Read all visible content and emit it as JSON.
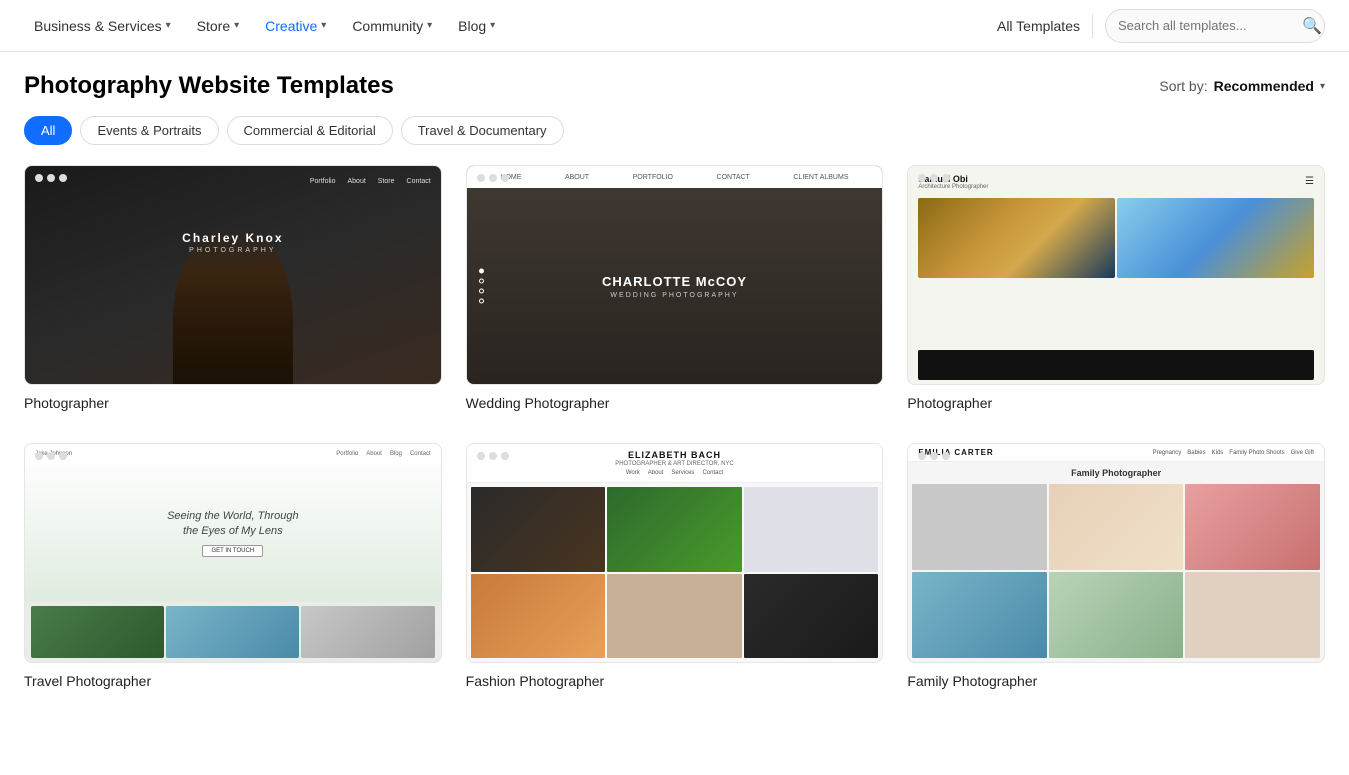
{
  "nav": {
    "items": [
      {
        "label": "Business & Services",
        "active": false,
        "has_chevron": true
      },
      {
        "label": "Store",
        "active": false,
        "has_chevron": true
      },
      {
        "label": "Creative",
        "active": true,
        "has_chevron": true
      },
      {
        "label": "Community",
        "active": false,
        "has_chevron": true
      },
      {
        "label": "Blog",
        "active": false,
        "has_chevron": true
      }
    ],
    "all_templates": "All Templates",
    "search_placeholder": "Search all templates..."
  },
  "page": {
    "title": "Photography Website Templates",
    "sort_label": "Sort by:",
    "sort_value": "Recommended"
  },
  "filters": [
    {
      "label": "All",
      "active": true
    },
    {
      "label": "Events & Portraits",
      "active": false
    },
    {
      "label": "Commercial & Editorial",
      "active": false
    },
    {
      "label": "Travel & Documentary",
      "active": false
    }
  ],
  "templates": [
    {
      "label": "Photographer",
      "name": "charley-knox",
      "row": 1
    },
    {
      "label": "Wedding Photographer",
      "name": "charlotte-mccoy",
      "row": 1
    },
    {
      "label": "Photographer",
      "name": "samuel-obi",
      "row": 1
    },
    {
      "label": "Travel Photographer",
      "name": "travel",
      "row": 2
    },
    {
      "label": "Fashion Photographer",
      "name": "elizabeth-bach",
      "row": 2
    },
    {
      "label": "Family Photographer",
      "name": "emilia-carter",
      "row": 2
    }
  ]
}
